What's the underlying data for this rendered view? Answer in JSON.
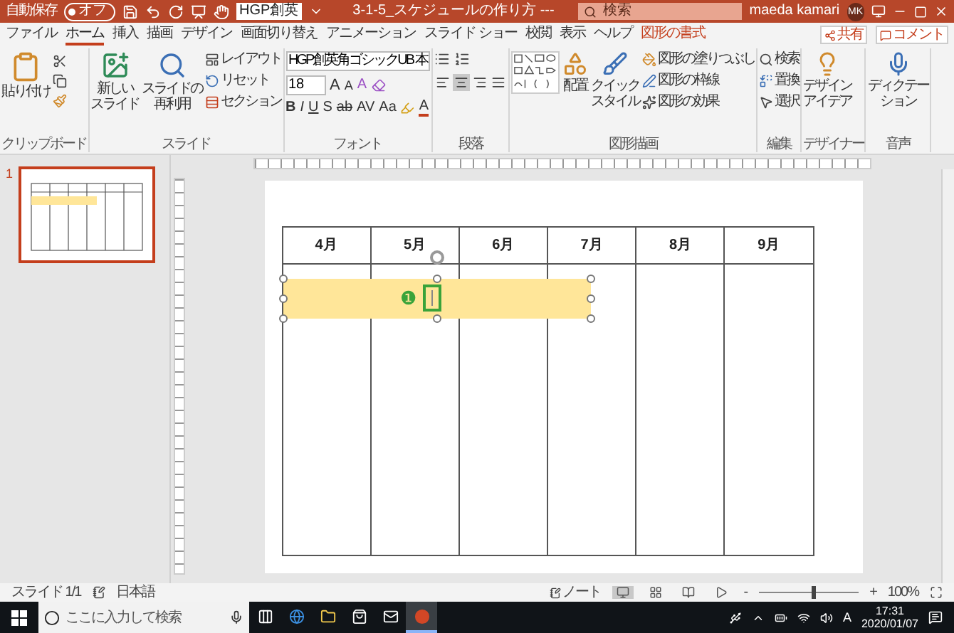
{
  "title_bar": {
    "autosave_label": "自動保存",
    "autosave": {
      "on": false,
      "label": "オフ"
    },
    "font_box": "HGP創英",
    "title": "3-1-5_スケジュールの作り方 ---",
    "search": {
      "placeholder": "検索"
    },
    "user": "maeda kamari",
    "avatar": "MK"
  },
  "tabs": [
    {
      "label": "ファイル",
      "selected": false,
      "kind": "normal"
    },
    {
      "label": "ホーム",
      "selected": true,
      "kind": "normal"
    },
    {
      "label": "挿入",
      "selected": false,
      "kind": "normal"
    },
    {
      "label": "描画",
      "selected": false,
      "kind": "normal"
    },
    {
      "label": "デザイン",
      "selected": false,
      "kind": "normal"
    },
    {
      "label": "画面切り替え",
      "selected": false,
      "kind": "normal"
    },
    {
      "label": "アニメーション",
      "selected": false,
      "kind": "normal"
    },
    {
      "label": "スライド ショー",
      "selected": false,
      "kind": "normal"
    },
    {
      "label": "校閲",
      "selected": false,
      "kind": "normal"
    },
    {
      "label": "表示",
      "selected": false,
      "kind": "normal"
    },
    {
      "label": "ヘルプ",
      "selected": false,
      "kind": "normal"
    },
    {
      "label": "図形の書式",
      "selected": false,
      "kind": "contextual"
    }
  ],
  "share": "共有",
  "comment": "コメント",
  "ribbon": {
    "clipboard": {
      "paste": "貼り付け",
      "label": "クリップボード"
    },
    "slides": {
      "new_slide": [
        "新しい",
        "スライド"
      ],
      "reuse": [
        "スライドの",
        "再利用"
      ],
      "layout": "レイアウト",
      "reset": "リセット",
      "section": "セクション",
      "label": "スライド"
    },
    "font": {
      "font_name": "HGP創英角ゴシックUB 本",
      "font_size": "18",
      "grow": "A",
      "shrink": "A",
      "clear": "A",
      "bold": "B",
      "italic": "I",
      "underline": "U",
      "shadow": "S",
      "strike": "ab",
      "spacing": "AV",
      "case": "Aa",
      "font_color": "A",
      "label": "フォント"
    },
    "paragraph": {
      "align": [
        {
          "kind": "left",
          "selected": false
        },
        {
          "kind": "center",
          "selected": true
        },
        {
          "kind": "right",
          "selected": false
        },
        {
          "kind": "justify",
          "selected": false
        }
      ],
      "label": "段落"
    },
    "drawing": {
      "arrange": "配置",
      "quick_styles": [
        "クイック",
        "スタイル"
      ],
      "fill": "図形の塗りつぶし",
      "outline": "図形の枠線",
      "effects": "図形の効果",
      "label": "図形描画"
    },
    "editing": {
      "find": "検索",
      "replace": "置換",
      "select": "選択",
      "label": "編集"
    },
    "designer": {
      "ideas": [
        "デザイン",
        "アイデア"
      ],
      "label": "デザイナー"
    },
    "voice": {
      "dictate": [
        "ディクテー",
        "ション"
      ],
      "label": "音声"
    }
  },
  "slides": [
    {
      "number": "1",
      "selected": true
    }
  ],
  "slide": {
    "table": {
      "columns": [
        "4月",
        "5月",
        "6月",
        "7月",
        "8月",
        "9月"
      ]
    },
    "shape": {
      "marker": "❶",
      "selected": true
    }
  },
  "status_bar": {
    "slide_count": "スライド 1/1",
    "language": "日本語",
    "notes": "ノート",
    "views": [
      {
        "kind": "normal",
        "selected": true
      },
      {
        "kind": "sorter",
        "selected": false
      },
      {
        "kind": "reading",
        "selected": false
      },
      {
        "kind": "show",
        "selected": false
      }
    ],
    "zoom_out": "-",
    "zoom_in": "+",
    "zoom": {
      "level": 0.55,
      "reading": "100%"
    }
  },
  "taskbar": {
    "search": {
      "placeholder": "ここに入力して検索"
    },
    "apps": [
      {
        "kind": "taskview",
        "selected": false
      },
      {
        "kind": "browser",
        "selected": false
      },
      {
        "kind": "folder",
        "selected": false
      },
      {
        "kind": "store",
        "selected": false
      },
      {
        "kind": "mail",
        "selected": false
      },
      {
        "kind": "slides",
        "selected": true
      }
    ],
    "ime": "A",
    "time": "17:31",
    "date": "2020/01/07"
  }
}
